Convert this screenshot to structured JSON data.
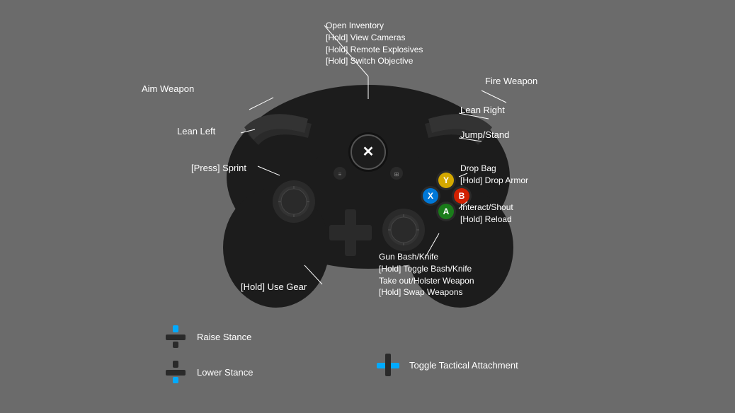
{
  "labels": {
    "open_inventory": "Open Inventory",
    "hold_view_cameras": "[Hold] View Cameras",
    "hold_remote_explosives": "[Hold] Remote Explosives",
    "hold_switch_objective": "[Hold] Switch Objective",
    "fire_weapon": "Fire Weapon",
    "lean_right": "Lean Right",
    "jump_stand": "Jump/Stand",
    "aim_weapon": "Aim Weapon",
    "lean_left": "Lean Left",
    "press_sprint": "[Press] Sprint",
    "drop_bag": "Drop Bag",
    "hold_drop_armor": "[Hold] Drop Armor",
    "interact_shout": "Interact/Shout",
    "hold_reload": "[Hold] Reload",
    "gun_bash_knife": "Gun Bash/Knife",
    "hold_toggle_bash": "[Hold] Toggle Bash/Knife",
    "take_out_holster": "Take out/Holster Weapon",
    "hold_swap": "[Hold] Swap Weapons",
    "hold_use_gear": "[Hold] Use Gear",
    "raise_stance": "Raise Stance",
    "lower_stance": "Lower Stance",
    "toggle_tactical": "Toggle Tactical Attachment",
    "xbox_logo": "✕"
  },
  "colors": {
    "background": "#6b6b6b",
    "controller_body": "#1a1a1a",
    "controller_dark": "#111111",
    "white": "#ffffff",
    "blue_accent": "#00aaff",
    "y_button": "#d4a800",
    "x_button": "#0078d7",
    "b_button": "#d12000",
    "a_button": "#1a7c1a",
    "xbox_ring": "#ffffff"
  }
}
